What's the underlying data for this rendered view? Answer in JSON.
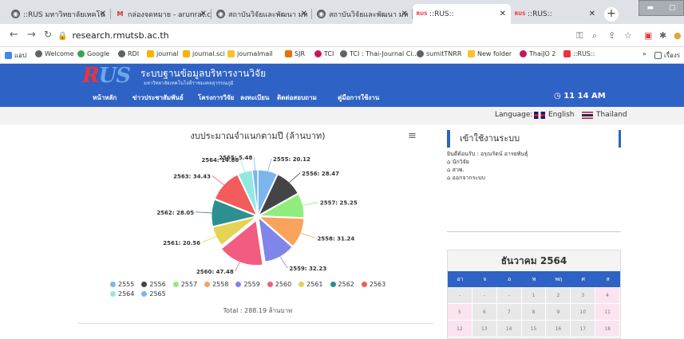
{
  "browser": {
    "tabs": [
      {
        "label": "::RUS มหาวิทยาลัยเทคโน",
        "icon": "chrome-icon"
      },
      {
        "label": "กล่องจดหมาย - arunrat.c",
        "icon": "gmail-icon"
      },
      {
        "label": "สถาบันวิจัยและพัฒนา มห",
        "icon": "chrome-icon"
      },
      {
        "label": "สถาบันวิจัยและพัฒนา มห",
        "icon": "chrome-icon"
      },
      {
        "label": "::RUS::",
        "icon": "rus-icon"
      },
      {
        "label": "::RUS::",
        "icon": "rus-icon"
      }
    ],
    "new_tab": "+",
    "url": "research.rmutsb.ac.th",
    "bookmarks": [
      "แอป",
      "Welcome",
      "Google",
      "RDI",
      "journal",
      "journal.sci",
      "journalmail",
      "SJR",
      "TCI",
      "TCI : Thai-Journal Ci...",
      "sumitTNRR",
      "New folder",
      "ThaiJO 2",
      "::RUS::"
    ],
    "bookmarks_more": "»",
    "reading_list": "เรื่องร"
  },
  "site": {
    "logo": {
      "r": "R",
      "us": "US"
    },
    "system_title": "ระบบฐานข้อมูลบริหารงานวิจัย",
    "system_subtitle": "มหาวิทยาลัยเทคโนโลยีราชมงคลสุวรรณภูมิ",
    "menu": [
      "หน้าหลัก",
      "ข่าวประชาสัมพันธ์",
      "โครงการวิจัย",
      "ลงทะเบียน",
      "ติดต่อสอบถาม",
      "คู่มือการใช้งาน"
    ],
    "clock": "11 14 AM",
    "language_label": "Language:",
    "lang_english": "English",
    "lang_thai": "Thailand"
  },
  "chart_data": {
    "type": "pie",
    "title": "งบประมาณจำแนกตามปี (ล้านบาท)",
    "categories": [
      "2555",
      "2556",
      "2557",
      "2558",
      "2559",
      "2560",
      "2561",
      "2562",
      "2563",
      "2564",
      "2565"
    ],
    "values": [
      20.12,
      28.47,
      25.25,
      31.24,
      32.23,
      47.48,
      20.56,
      28.05,
      34.43,
      14.88,
      5.48
    ],
    "colors": [
      "#7cb5ec",
      "#434348",
      "#90ed7d",
      "#f7a35c",
      "#8085e9",
      "#f15c80",
      "#e4d354",
      "#2b908f",
      "#f45b5b",
      "#91e8e1",
      "#7cb5ec"
    ],
    "slice_labels": [
      "2555: 20.12",
      "2556: 28.47",
      "2557: 25.25",
      "2558: 31.24",
      "2559: 32.23",
      "2560: 47.48",
      "2561: 20.56",
      "2562: 28.05",
      "2563: 34.43",
      "2564: 14.88",
      "2565: 5.48"
    ],
    "legend_placement": "bottom",
    "total_text": "Total : 288.19 ล้านบาท",
    "menu_icon": "hamburger-icon"
  },
  "login": {
    "heading": "เข้าใช้งานระบบ",
    "welcome": "ยินดีต้อนรับ : อรุณรัตน์ อารยพันธุ์",
    "links": [
      "นักวิจัย",
      "สวพ.",
      "ออกจากระบบ"
    ]
  },
  "calendar": {
    "title": "ธันวาคม 2564",
    "days": [
      "อา",
      "จ",
      "อ",
      "พ",
      "พฤ",
      "ศ",
      "ส"
    ],
    "rows": [
      [
        "-",
        "-",
        "-",
        "1",
        "2",
        "3",
        "4"
      ],
      [
        "5",
        "6",
        "7",
        "8",
        "9",
        "10",
        "11"
      ],
      [
        "12",
        "13",
        "14",
        "15",
        "16",
        "17",
        "18"
      ]
    ]
  }
}
